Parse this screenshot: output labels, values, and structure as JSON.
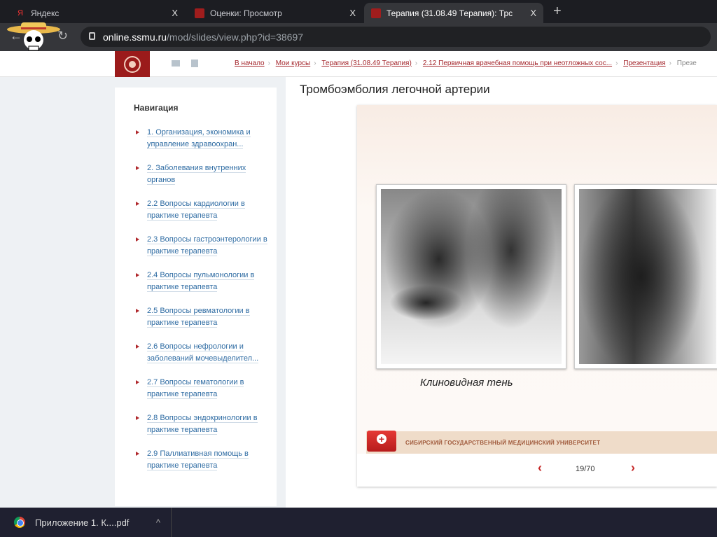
{
  "tabs": [
    {
      "label": "Яндекс",
      "icon": "yandex-icon"
    },
    {
      "label": "Оценки: Просмотр",
      "icon": "ssmu-icon"
    },
    {
      "label": "Терапия (31.08.49 Терапия): Трс",
      "icon": "ssmu-icon",
      "active": true
    }
  ],
  "url": {
    "host": "online.ssmu.ru",
    "path": "/mod/slides/view.php?id=38697"
  },
  "breadcrumbs": [
    "В начало",
    "Мои курсы",
    "Терапия (31.08.49 Терапия)",
    "2.12 Первичная врачебная помощь при неотложных сос...",
    "Презентация",
    "Презе"
  ],
  "sidebar": {
    "title": "Навигация",
    "items": [
      "1. Организация, экономика и управление здравоохран...",
      "2. Заболевания внутренних органов",
      "2.2 Вопросы кардиологии в практике терапевта",
      "2.3 Вопросы гастроэнтерологии в практике терапевта",
      "2.4 Вопросы пульмонологии в практике терапевта",
      "2.5 Вопросы ревматологии в практике терапевта",
      "2.6 Вопросы нефрологии и заболеваний мочевыделител...",
      "2.7 Вопросы гематологии в практике терапевта",
      "2.8 Вопросы эндокринологии в практике терапевта",
      "2.9 Паллиативная помощь в практике терапевта"
    ]
  },
  "main": {
    "title": "Тромбоэмболия легочной артерии",
    "slide": {
      "caption": "Клиновидная тень",
      "footer": "СИБИРСКИЙ ГОСУДАРСТВЕННЫЙ МЕДИЦИНСКИЙ УНИВЕРСИТЕТ",
      "counter": "19/70",
      "prev": "‹",
      "next": "›"
    }
  },
  "download": {
    "filename": "Приложение 1. К....pdf"
  },
  "symbols": {
    "close": "X",
    "plus": "+",
    "back": "←",
    "reload": "↻",
    "caret": "^",
    "yandex": "Я"
  }
}
